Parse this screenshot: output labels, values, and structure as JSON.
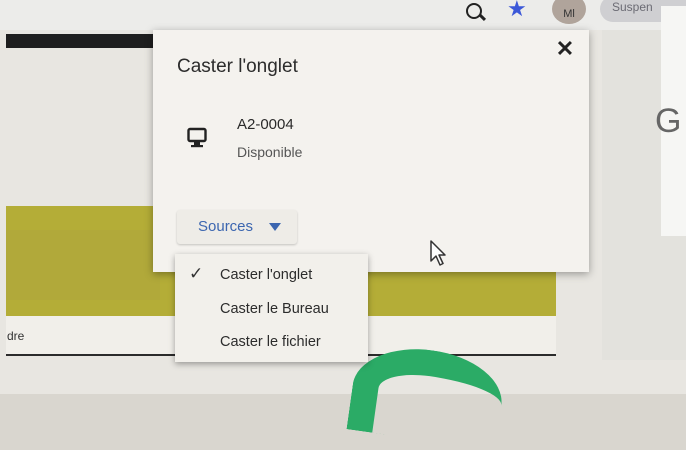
{
  "browser": {
    "profile_label": "Suspen",
    "avatar_initials": "Ml"
  },
  "page": {
    "footer_text": "dre",
    "right_glyph": "G"
  },
  "cast_dialog": {
    "title": "Caster l'onglet",
    "close_symbol": "✕",
    "device": {
      "name": "A2-0004",
      "status": "Disponible"
    },
    "sources_label": "Sources",
    "menu": {
      "items": [
        {
          "label": "Caster l'onglet",
          "checked": true,
          "check_symbol": "✓"
        },
        {
          "label": "Caster le Bureau",
          "checked": false,
          "check_symbol": ""
        },
        {
          "label": "Caster le fichier",
          "checked": false,
          "check_symbol": ""
        }
      ]
    }
  },
  "colors": {
    "accent_blue": "#3c66b0",
    "olive": "#b4ad37",
    "green": "#2bab66"
  }
}
